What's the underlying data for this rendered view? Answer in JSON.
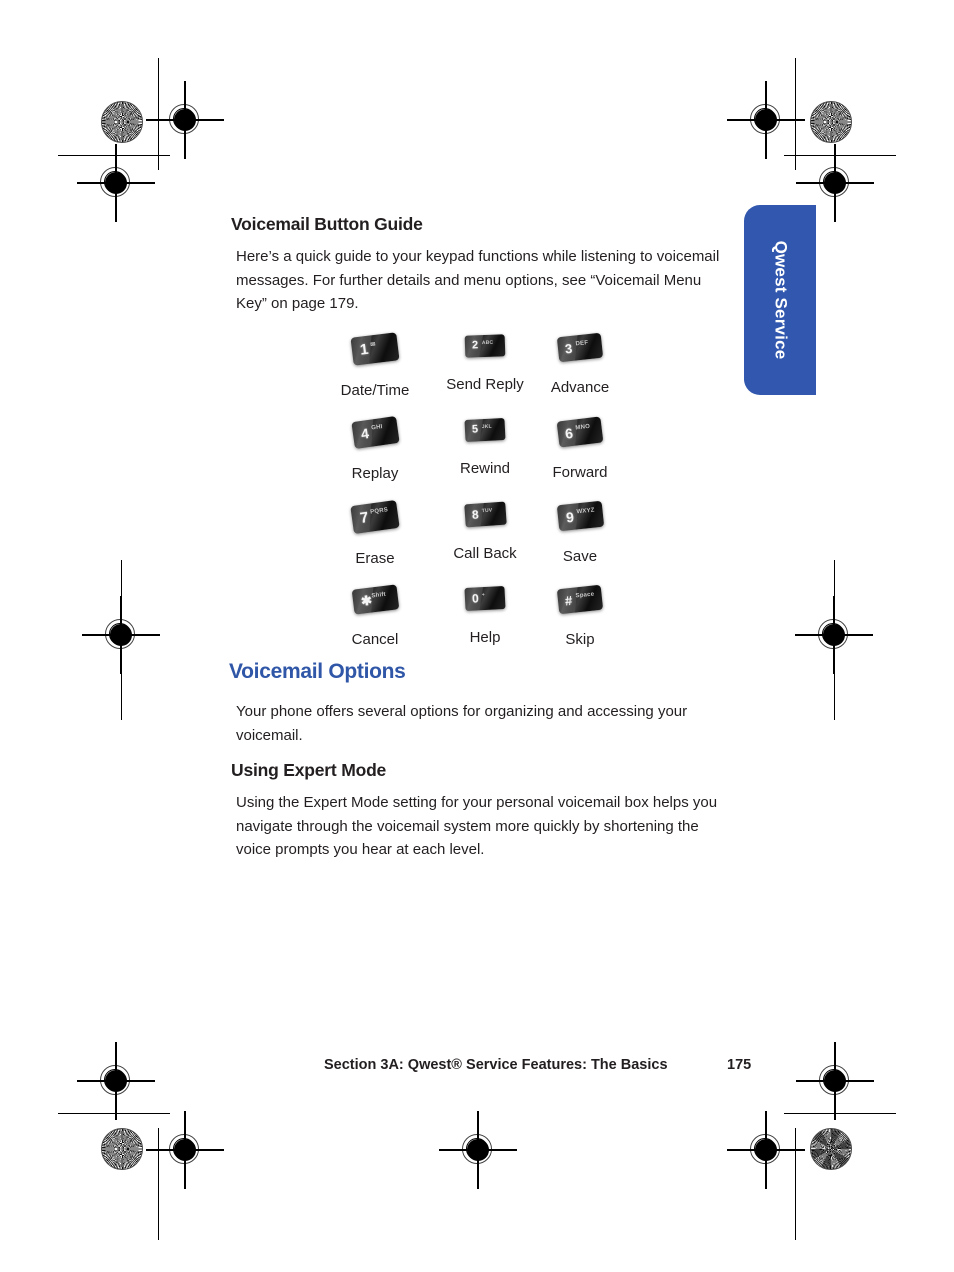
{
  "page": {
    "number": "175",
    "footer_text": "Section 3A: Qwest® Service Features: The Basics"
  },
  "side_tab": {
    "label": "Qwest Service",
    "color": "#3158ae"
  },
  "sections": {
    "button_guide": {
      "heading": "Voicemail Button Guide",
      "intro": "Here’s a quick guide to your keypad functions while listening to voicemail messages. For further details and menu options, see “Voicemail Menu Key” on page 179."
    },
    "voicemail_options": {
      "heading": "Voicemail Options",
      "heading_color": "#2f56a7",
      "body": "Your phone offers several options for organizing and accessing your voicemail."
    },
    "expert_mode": {
      "heading": "Using Expert Mode",
      "body": "Using the Expert Mode setting for your personal voicemail box helps you navigate through the voicemail system more quickly by shortening the voice prompts you hear at each level."
    }
  },
  "keypad_buttons": [
    {
      "digit": "1",
      "sub": "✉",
      "label": "Date/Time"
    },
    {
      "digit": "2",
      "sub": "ABC",
      "label": "Send Reply"
    },
    {
      "digit": "3",
      "sub": "DEF",
      "label": "Advance"
    },
    {
      "digit": "4",
      "sub": "GHI",
      "label": "Replay"
    },
    {
      "digit": "5",
      "sub": "JKL",
      "label": "Rewind"
    },
    {
      "digit": "6",
      "sub": "MNO",
      "label": "Forward"
    },
    {
      "digit": "7",
      "sub": "PQRS",
      "label": "Erase"
    },
    {
      "digit": "8",
      "sub": "TUV",
      "label": "Call Back"
    },
    {
      "digit": "9",
      "sub": "WXYZ",
      "label": "Save"
    },
    {
      "digit": "✱",
      "sub": "Shift",
      "label": "Cancel"
    },
    {
      "digit": "0",
      "sub": "+",
      "label": "Help"
    },
    {
      "digit": "#",
      "sub": "Space",
      "label": "Skip"
    }
  ]
}
